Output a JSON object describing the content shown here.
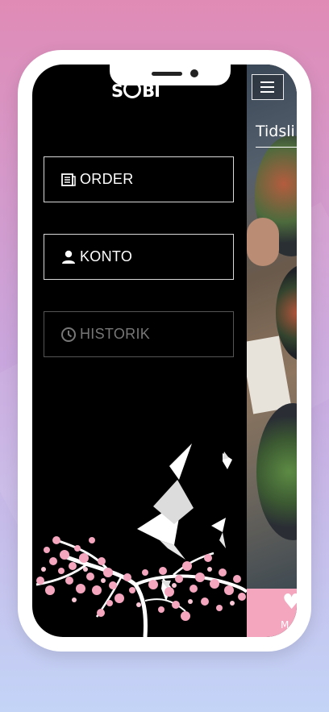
{
  "app": {
    "logo_text": "SOBI"
  },
  "nav": [
    {
      "label": "ORDER",
      "icon": "order-receipt-icon",
      "enabled": true
    },
    {
      "label": "KONTO",
      "icon": "user-icon",
      "enabled": true
    },
    {
      "label": "HISTORIK",
      "icon": "clock-icon",
      "enabled": false
    }
  ],
  "content": {
    "title": "Tidsli",
    "favorite_label": "M"
  },
  "colors": {
    "accent_pink": "#f4a6bf",
    "drawer_bg": "#000000",
    "blossom": "#f4a6bf"
  }
}
